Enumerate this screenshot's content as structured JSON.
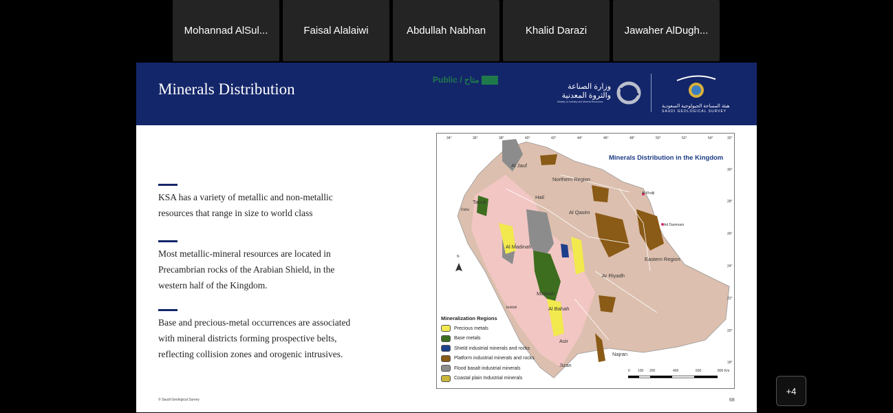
{
  "participants": [
    "Mohannad AlSul...",
    "Faisal Alalaiwi",
    "Abdullah Nabhan",
    "Khalid Darazi",
    "Jawaher AlDugh..."
  ],
  "slide": {
    "title": "Minerals Distribution",
    "classification": "Public / متاح",
    "ministry_ar": "وزارة الصناعة والثروة المعدنية",
    "ministry_en": "Ministry of Industry and Mineral Resources",
    "sgs_ar": "هيئة المساحة الجيولوجية السعودية",
    "sgs_en": "SAUDI GEOLOGICAL SURVEY",
    "bullets": [
      "KSA has a variety of metallic and non-metallic resources that range in size to world class",
      "Most metallic-mineral resources are located in Precambrian rocks of the Arabian Shield,  in the western half of the Kingdom.",
      "Base and precious-metal occurrences are associated with mineral districts forming prospective belts, reflecting collision zones and orogenic intrusives."
    ],
    "footer": "© Saudi Geological Survey",
    "page_number": "68"
  },
  "map": {
    "title": "Minerals Distribution in the Kingdom",
    "legend_title": "Mineralization Regions",
    "legend": [
      {
        "label": "Precious metals",
        "color": "#f2e94e"
      },
      {
        "label": "Base metals",
        "color": "#3d6e1f"
      },
      {
        "label": "Shield industrial minerals and rocks",
        "color": "#1e3f8a"
      },
      {
        "label": "Platform industrial minerals and rocks",
        "color": "#8a5a17"
      },
      {
        "label": "Flood basalt industrial minerals",
        "color": "#8c8c8c"
      },
      {
        "label": "Coastal plain Industrial minerals",
        "color": "#c9b63a"
      }
    ],
    "regions": [
      "Al Jauf",
      "Northern Region",
      "Tabuk",
      "Hail",
      "Al Qasim",
      "Al Madinah",
      "Ar Riyadh",
      "Eastern Region",
      "Makkah",
      "Al Bahah",
      "Asir",
      "Jizan",
      "Najran"
    ],
    "cities": [
      "Al Khafji",
      "Ad Dammam",
      "Duba",
      "Jeddah"
    ],
    "lon_ticks": [
      "34°",
      "36°",
      "38°",
      "40°",
      "42°",
      "44°",
      "46°",
      "48°",
      "50°",
      "52°",
      "54°"
    ],
    "lat_ticks": [
      "32°",
      "30°",
      "28°",
      "26°",
      "24°",
      "22°",
      "20°",
      "18°"
    ],
    "scale_labels": [
      "0",
      "100",
      "200",
      "400",
      "600",
      "800 Km"
    ],
    "north": "N"
  },
  "overflow_button": "+4"
}
